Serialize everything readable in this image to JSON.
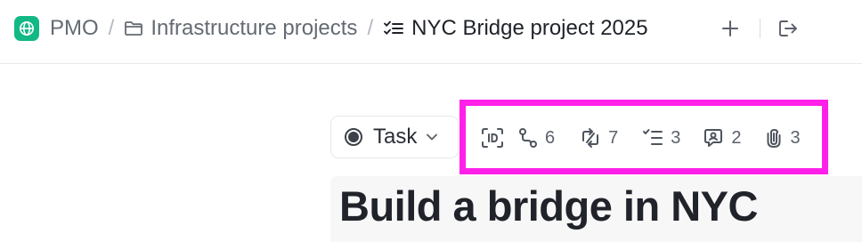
{
  "breadcrumb": {
    "space": "PMO",
    "folder": "Infrastructure projects",
    "list": "NYC Bridge project 2025",
    "separator": "/"
  },
  "icons": {
    "space": "globe-icon",
    "folder": "folder-icon",
    "list": "checklist-icon",
    "add": "plus-icon",
    "exit": "exit-icon"
  },
  "task": {
    "type_label": "Task",
    "title": "Build a bridge in NYC"
  },
  "meta": [
    {
      "icon": "id-icon",
      "count": ""
    },
    {
      "icon": "route-icon",
      "count": "6"
    },
    {
      "icon": "relationships-icon",
      "count": "7"
    },
    {
      "icon": "checklist-icon",
      "count": "3"
    },
    {
      "icon": "comment-icon",
      "count": "2"
    },
    {
      "icon": "attachment-icon",
      "count": "3"
    }
  ],
  "colors": {
    "space_avatar": "#12b886",
    "highlight": "#ff1fe8"
  }
}
